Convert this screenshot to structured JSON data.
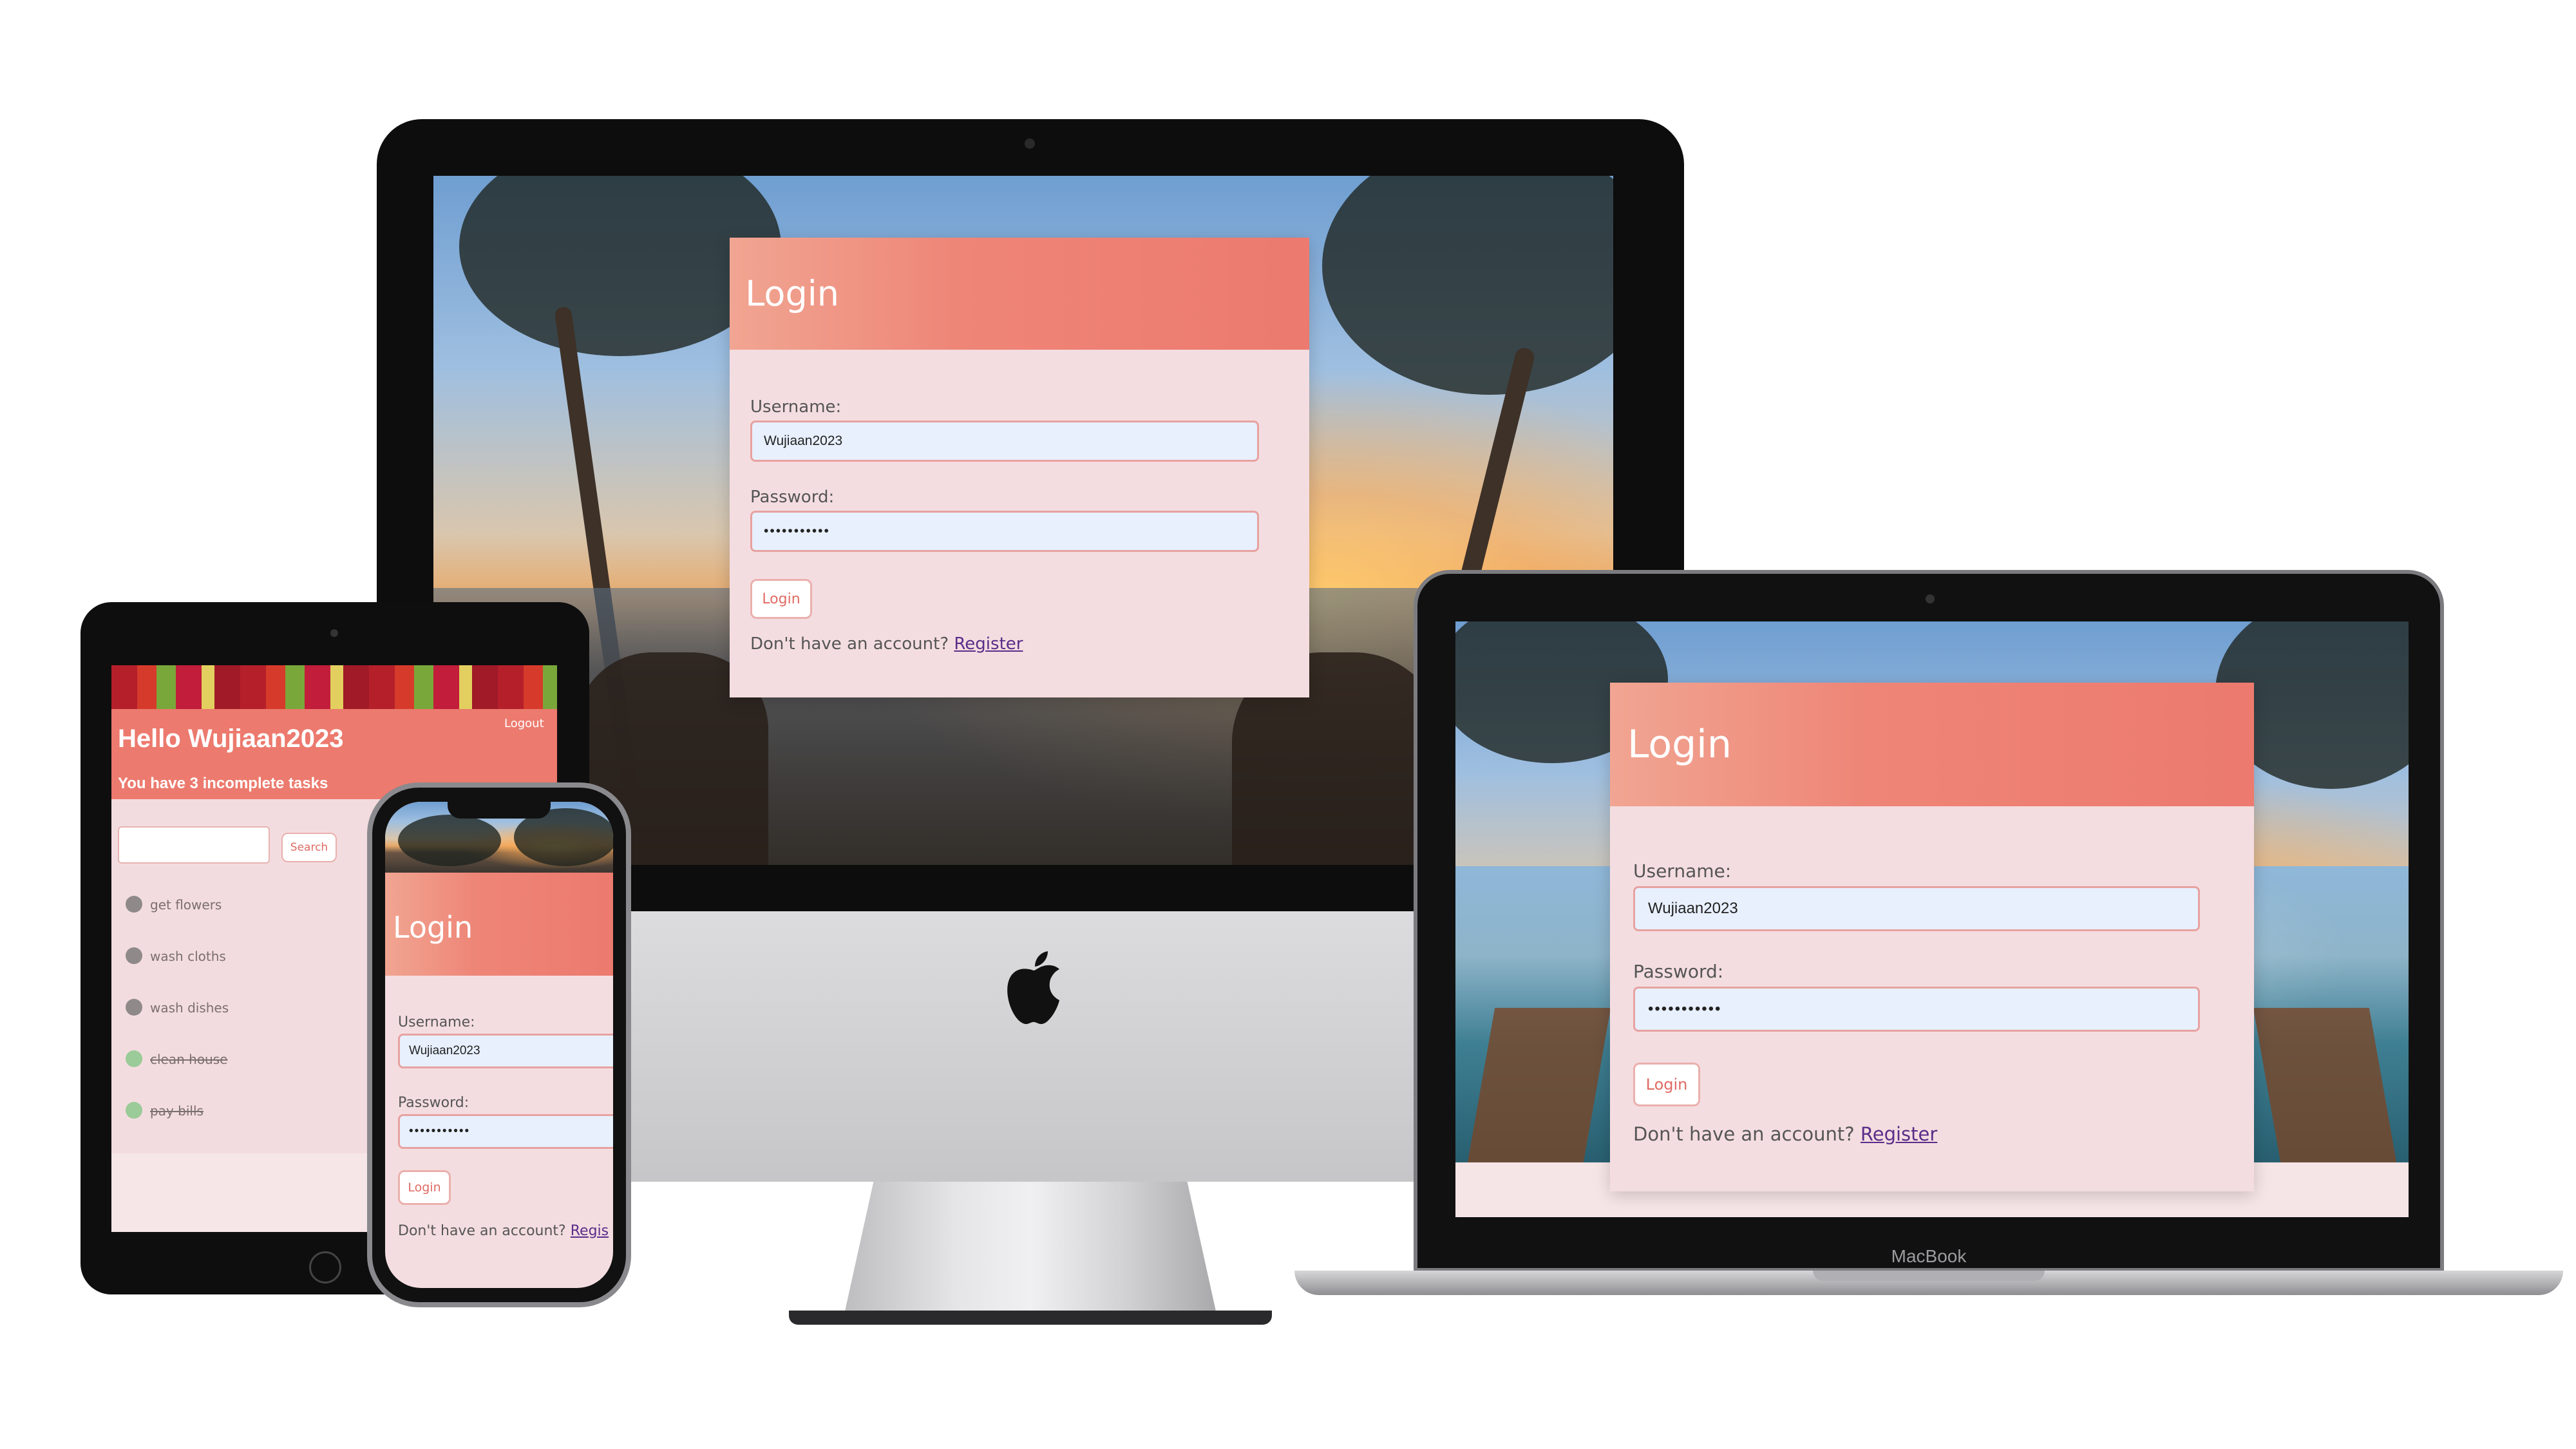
{
  "login": {
    "title": "Login",
    "username_label": "Username:",
    "username_value": "Wujiaan2023",
    "password_label": "Password:",
    "password_value": "•••••••••••",
    "button_label": "Login",
    "register_prompt": "Don't have an account?",
    "register_link": "Register",
    "register_link_phone": "Regis"
  },
  "laptop": {
    "brand": "MacBook"
  },
  "tablet": {
    "greeting": "Hello Wujiaan2023",
    "logout": "Logout",
    "subtitle": "You have 3 incomplete tasks",
    "search_button": "Search",
    "tasks": [
      {
        "label": "get flowers",
        "done": false
      },
      {
        "label": "wash cloths",
        "done": false
      },
      {
        "label": "wash dishes",
        "done": false
      },
      {
        "label": "clean house",
        "done": true
      },
      {
        "label": "pay bills",
        "done": true
      }
    ]
  },
  "colors": {
    "accent": "#ec7a6e",
    "card_bg": "#f4dde0",
    "link": "#5a2d8a",
    "task_open": "#8f8a89",
    "task_done": "#9acb98"
  }
}
